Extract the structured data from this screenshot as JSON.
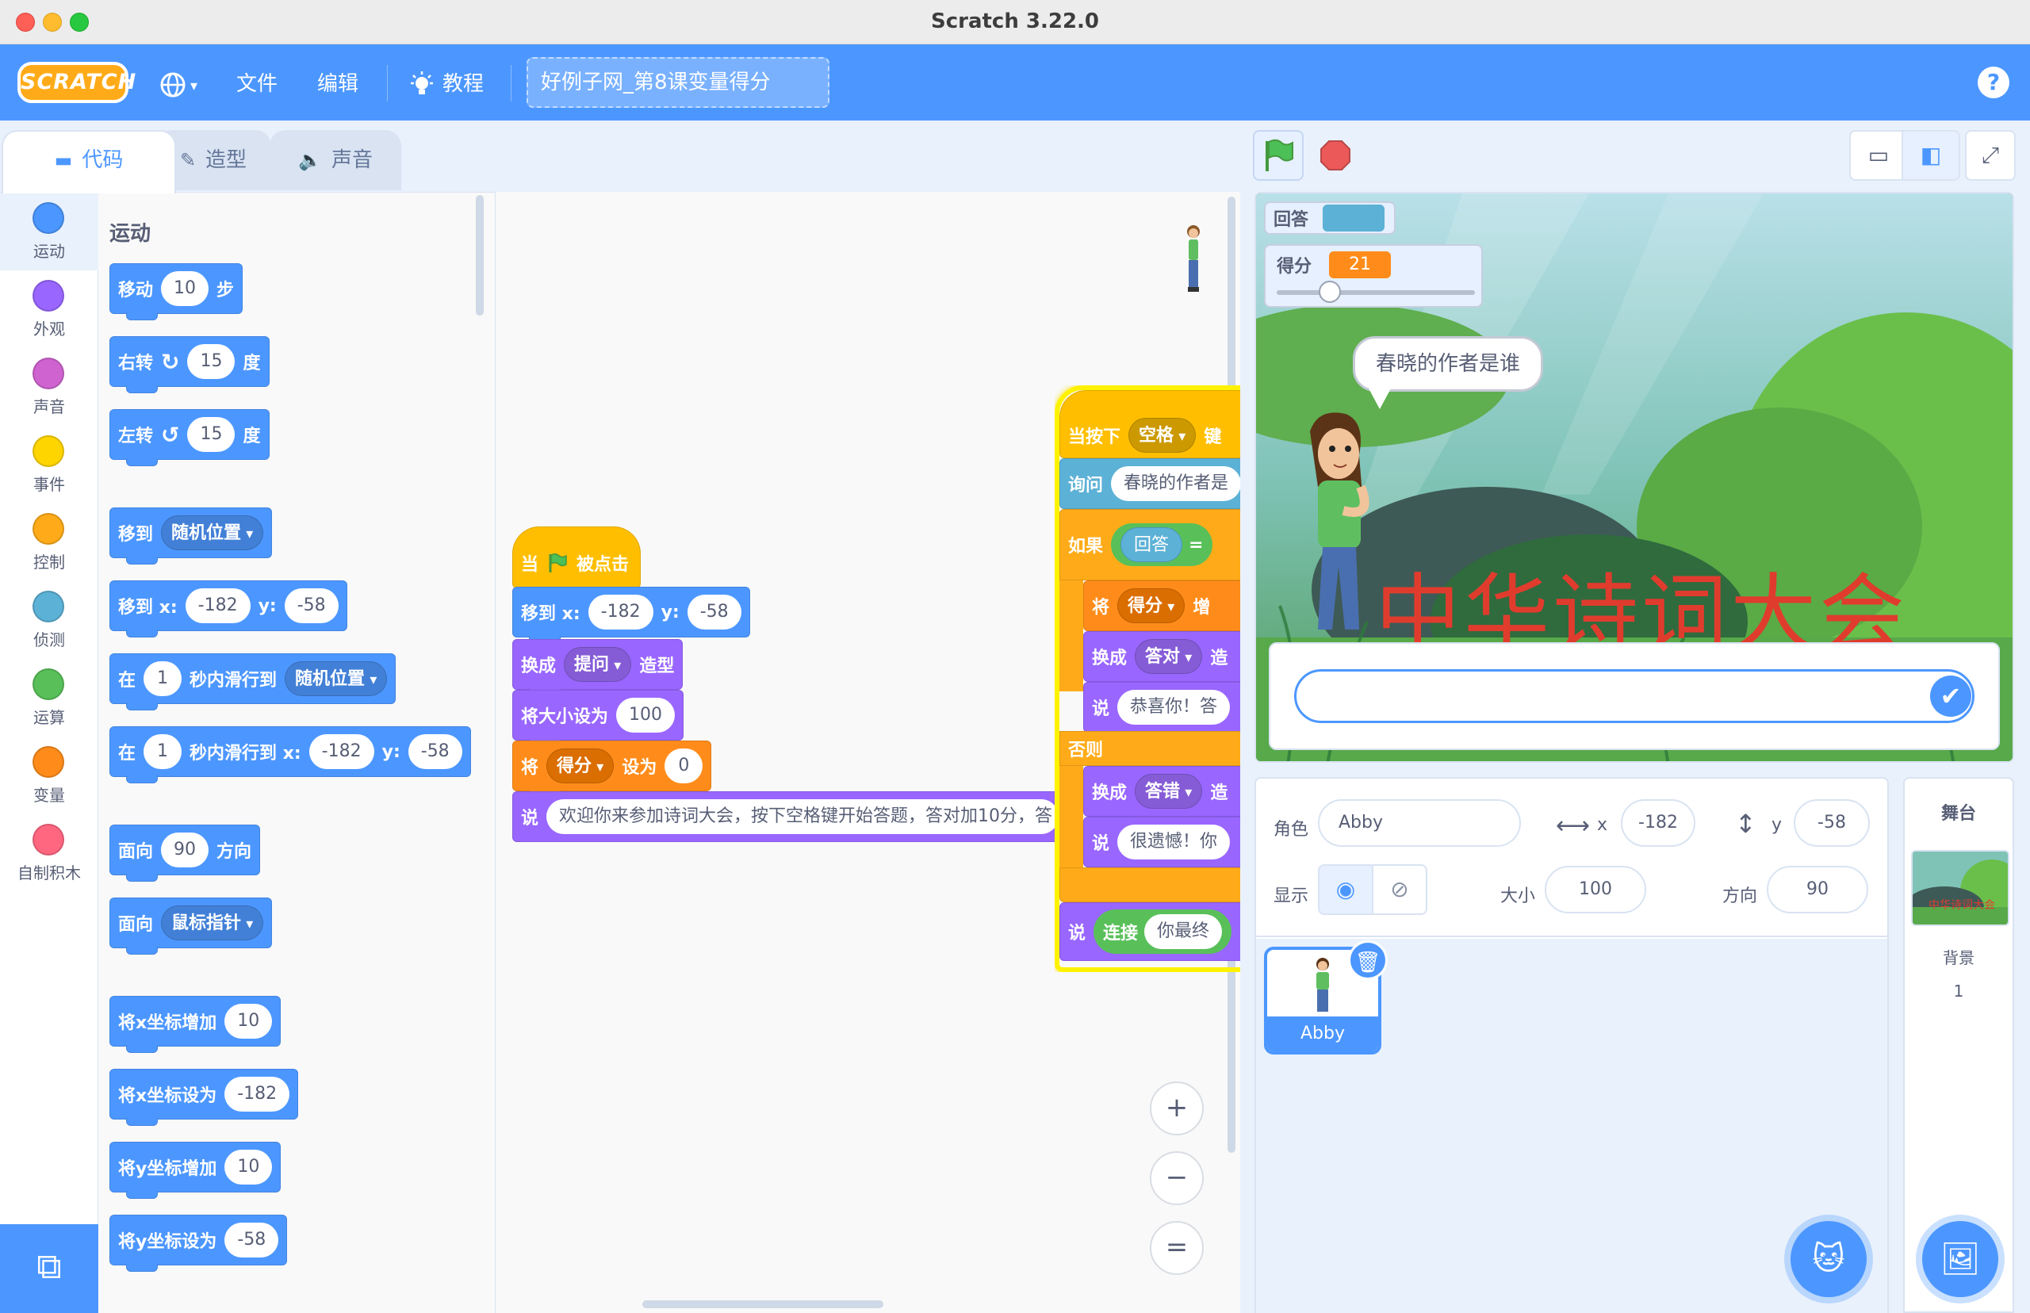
{
  "window": {
    "title": "Scratch 3.22.0"
  },
  "menubar": {
    "logo": "SCRATCH",
    "language_icon": "globe-icon",
    "file": "文件",
    "edit": "编辑",
    "tutorials": "教程",
    "project_title": "好例子网_第8课变量得分",
    "help": "?"
  },
  "tabs": {
    "code": "代码",
    "costumes": "造型",
    "sounds": "声音"
  },
  "categories": [
    {
      "label": "运动",
      "color": "#4c97ff"
    },
    {
      "label": "外观",
      "color": "#9966ff"
    },
    {
      "label": "声音",
      "color": "#cf63cf"
    },
    {
      "label": "事件",
      "color": "#ffd500"
    },
    {
      "label": "控制",
      "color": "#ffab19"
    },
    {
      "label": "侦测",
      "color": "#5cb1d6"
    },
    {
      "label": "运算",
      "color": "#59c059"
    },
    {
      "label": "变量",
      "color": "#ff8c1a"
    },
    {
      "label": "自制积木",
      "color": "#ff6680"
    }
  ],
  "palette": {
    "section_title": "运动",
    "move": {
      "label": "移动",
      "steps": "10",
      "suffix": "步"
    },
    "turn_right": {
      "label": "右转",
      "deg": "15",
      "suffix": "度"
    },
    "turn_left": {
      "label": "左转",
      "deg": "15",
      "suffix": "度"
    },
    "goto": {
      "label": "移到",
      "target": "随机位置"
    },
    "goto_xy": {
      "label": "移到 x:",
      "x": "-182",
      "ylabel": "y:",
      "y": "-58"
    },
    "glide_to": {
      "prefix": "在",
      "secs": "1",
      "mid": "秒内滑行到",
      "target": "随机位置"
    },
    "glide_xy": {
      "prefix": "在",
      "secs": "1",
      "mid": "秒内滑行到 x:",
      "x": "-182",
      "ylabel": "y:",
      "y": "-58"
    },
    "point_dir": {
      "label": "面向",
      "dir": "90",
      "suffix": "方向"
    },
    "point_towards": {
      "label": "面向",
      "target": "鼠标指针"
    },
    "change_x": {
      "label": "将x坐标增加",
      "val": "10"
    },
    "set_x": {
      "label": "将x坐标设为",
      "val": "-182"
    },
    "change_y": {
      "label": "将y坐标增加",
      "val": "10"
    },
    "set_y": {
      "label": "将y坐标设为",
      "val": "-58"
    }
  },
  "script1": {
    "hat_prefix": "当",
    "hat_suffix": "被点击",
    "goto_label": "移到 x:",
    "goto_x": "-182",
    "goto_ylabel": "y:",
    "goto_y": "-58",
    "switch_label": "换成",
    "switch_costume": "提问",
    "switch_suffix": "造型",
    "size_label": "将大小设为",
    "size_val": "100",
    "set_label": "将",
    "set_var": "得分",
    "set_mid": "设为",
    "set_val": "0",
    "say_label": "说",
    "say_text": "欢迎你来参加诗词大会，按下空格键开始答题，答对加10分，答"
  },
  "script2": {
    "hat_label": "当按下",
    "hat_key": "空格",
    "hat_suffix": "键",
    "ask_label": "询问",
    "ask_text": "春晓的作者是",
    "if_label": "如果",
    "answer_label": "回答",
    "eq": "=",
    "set_label": "将",
    "set_var": "得分",
    "set_suffix": "增",
    "sw1_label": "换成",
    "sw1_costume": "答对",
    "sw1_suffix": "造",
    "say1_label": "说",
    "say1_text": "恭喜你！答",
    "else_label": "否则",
    "sw2_label": "换成",
    "sw2_costume": "答错",
    "sw2_suffix": "造",
    "say2_label": "说",
    "say2_text": "很遗憾！你",
    "say3_label": "说",
    "join_label": "连接",
    "join_text": "你最终"
  },
  "zoom": {
    "in": "+",
    "out": "−",
    "reset": "="
  },
  "stage": {
    "monitor_answer_label": "回答",
    "monitor_answer_value": "",
    "monitor_score_label": "得分",
    "monitor_score_value": "21",
    "slider_position": 0.21,
    "speech": "春晓的作者是谁",
    "title_text": "中华诗词大会",
    "ask_value": ""
  },
  "sprite_info": {
    "sprite_label": "角色",
    "sprite_name": "Abby",
    "x_label": "x",
    "x_val": "-182",
    "y_label": "y",
    "y_val": "-58",
    "show_label": "显示",
    "size_label": "大小",
    "size_val": "100",
    "dir_label": "方向",
    "dir_val": "90"
  },
  "sprites": [
    {
      "name": "Abby"
    }
  ],
  "stage_target": {
    "title": "舞台",
    "backdrops_label": "背景",
    "backdrops_count": "1"
  }
}
